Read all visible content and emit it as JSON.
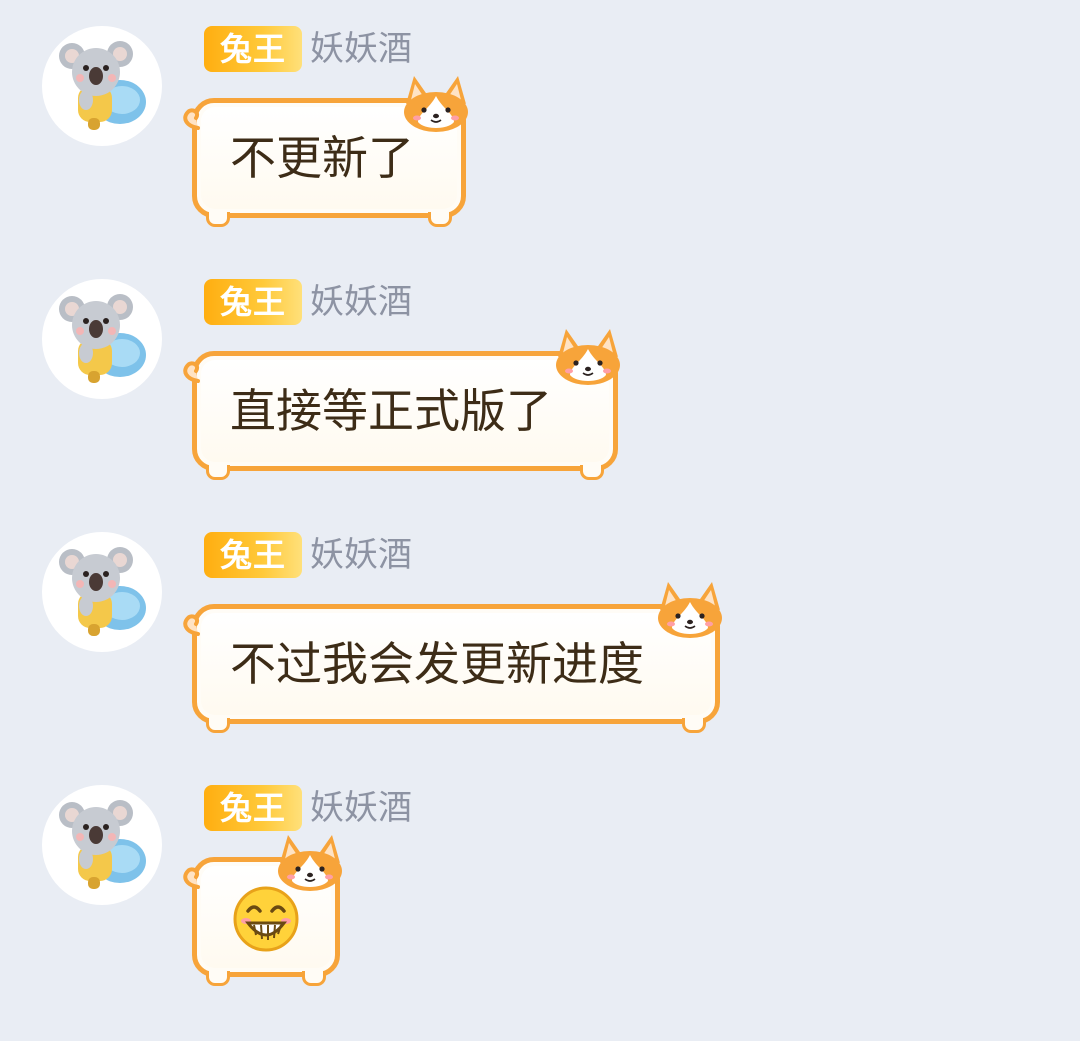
{
  "messages": [
    {
      "badge": "兔王",
      "sender": "妖妖酒",
      "text": "不更新了"
    },
    {
      "badge": "兔王",
      "sender": "妖妖酒",
      "text": "直接等正式版了"
    },
    {
      "badge": "兔王",
      "sender": "妖妖酒",
      "text": "不过我会发更新进度"
    },
    {
      "badge": "兔王",
      "sender": "妖妖酒",
      "emoji": "grinning-face-icon"
    }
  ],
  "colors": {
    "background": "#e9edf4",
    "badge": "#ffb020",
    "bubble_border": "#f7a43a",
    "text": "#3d2c17",
    "name": "#8d93a3"
  }
}
